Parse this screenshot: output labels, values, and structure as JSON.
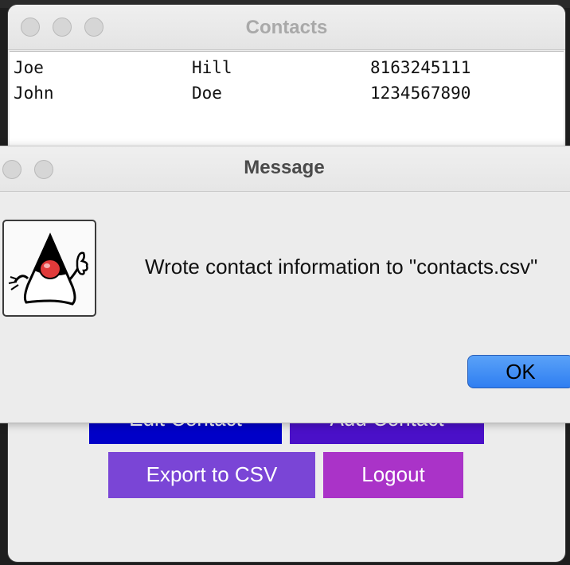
{
  "contacts_window": {
    "title": "Contacts",
    "rows": [
      {
        "first": "Joe",
        "last": "Hill",
        "phone": "8163245111"
      },
      {
        "first": "John",
        "last": "Doe",
        "phone": "1234567890"
      }
    ],
    "buttons": {
      "edit": "Edit Contact",
      "add": "Add Contact",
      "export": "Export to CSV",
      "logout": "Logout"
    }
  },
  "dialog": {
    "title": "Message",
    "icon": "java-duke-icon",
    "message": "Wrote contact information to \"contacts.csv\"",
    "ok_label": "OK"
  },
  "colors": {
    "edit": "#0000c8",
    "add": "#4a10c8",
    "export": "#7a45d6",
    "logout": "#aa33c8",
    "ok": "#3a86f3"
  }
}
